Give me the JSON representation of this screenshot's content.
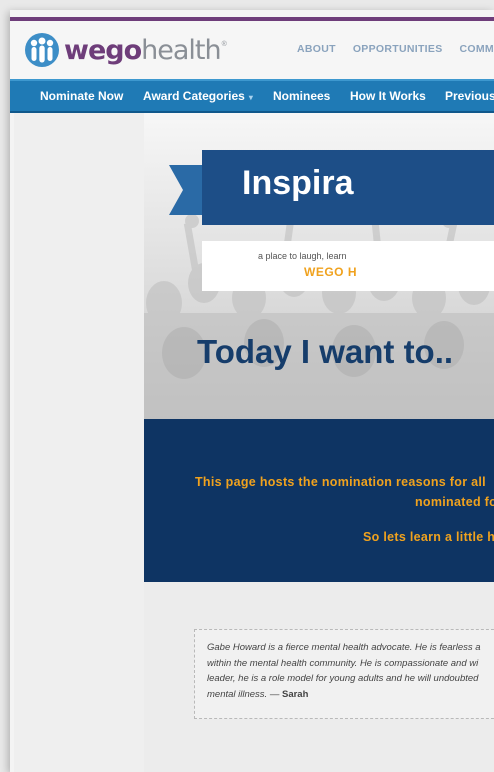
{
  "header": {
    "logo_wego": "wego",
    "logo_health": "health",
    "logo_reg": "®",
    "top_links": [
      "ABOUT",
      "OPPORTUNITIES",
      "COMMUNIT"
    ]
  },
  "nav": {
    "items": [
      {
        "label": "Nominate Now"
      },
      {
        "label": "Award Categories",
        "caret": "▾"
      },
      {
        "label": "Nominees"
      },
      {
        "label": "How It Works"
      },
      {
        "label": "Previous"
      }
    ]
  },
  "hero": {
    "title": "Inspira",
    "tagline": "a place to laugh, learn",
    "brand": "WEGO H",
    "today": "Today I want to.."
  },
  "info": {
    "line1": "This page hosts the nomination reasons for all",
    "line2": "nominated fo",
    "line3": "So lets learn a little h"
  },
  "quote": {
    "lines": [
      "Gabe Howard is a fierce mental health advocate. He is fearless a",
      "within the mental health community. He is compassionate and wi",
      "leader, he is a role model for young adults and he will undoubted",
      "mental illness. —"
    ],
    "author": "Sarah"
  },
  "colors": {
    "brand_purple": "#6e3d7a",
    "nav_blue": "#1f7ab5",
    "banner_navy": "#1d4e87",
    "info_navy": "#0e3463",
    "accent_orange": "#f0a21e"
  }
}
